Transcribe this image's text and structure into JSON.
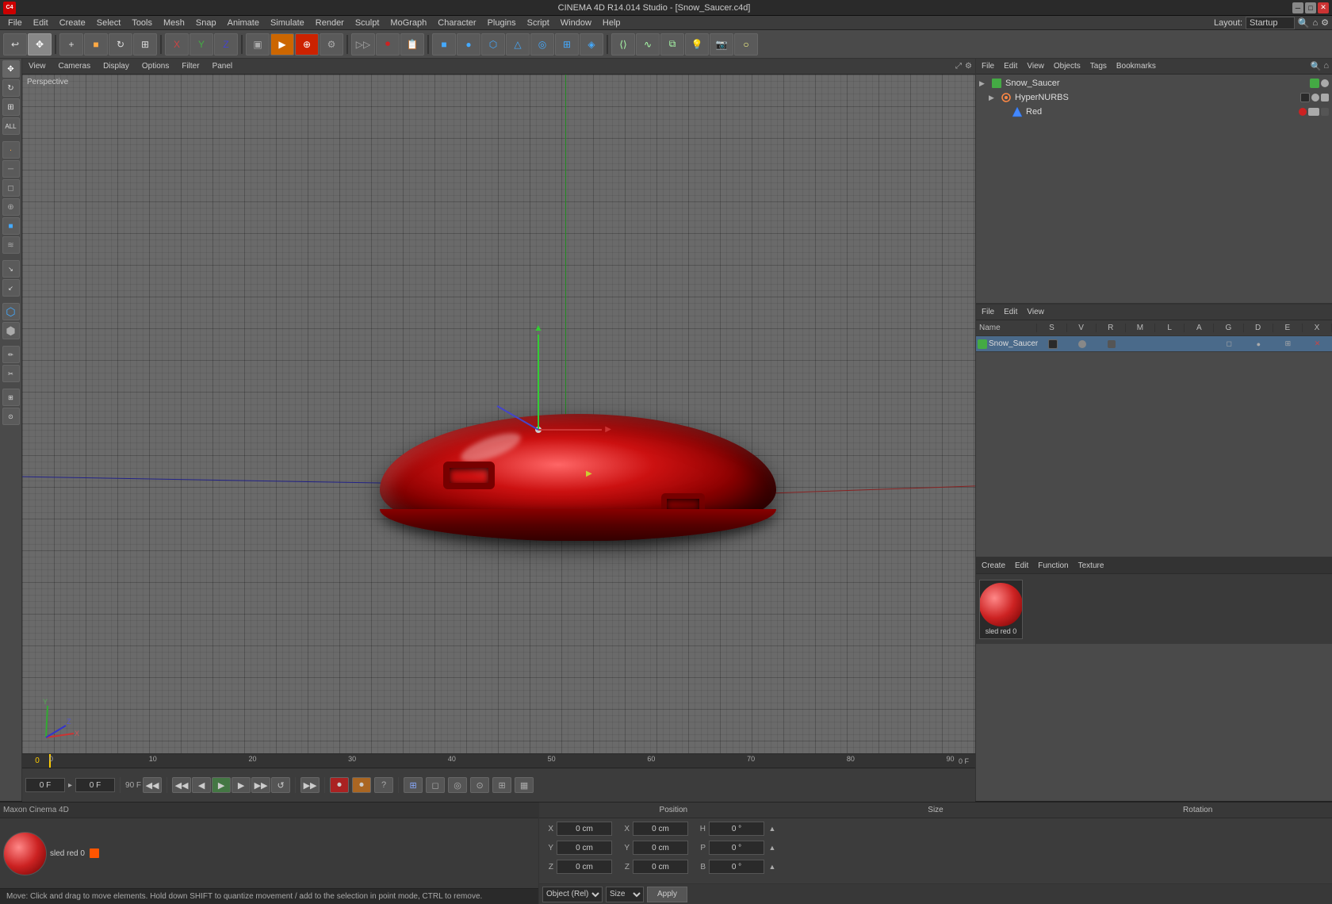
{
  "window": {
    "title": "CINEMA 4D R14.014 Studio - [Snow_Saucer.c4d]",
    "layout_label": "Layout:",
    "layout_value": "Startup"
  },
  "menubar": {
    "items": [
      "File",
      "Edit",
      "Create",
      "Select",
      "Tools",
      "Mesh",
      "Snap",
      "Animate",
      "Simulate",
      "Render",
      "Sculpt",
      "MoGraph",
      "Character",
      "Plugins",
      "Script",
      "Window",
      "Help"
    ]
  },
  "viewport": {
    "label": "Perspective",
    "menus": [
      "View",
      "Cameras",
      "Display",
      "Options",
      "Filter",
      "Panel"
    ]
  },
  "object_manager": {
    "toolbar": [
      "File",
      "Edit",
      "View",
      "Objects",
      "Tags",
      "Bookmarks"
    ],
    "objects": [
      {
        "name": "Snow_Saucer",
        "level": 0,
        "type": "null",
        "expanded": true
      },
      {
        "name": "HyperNURBS",
        "level": 1,
        "type": "hypernurbs",
        "expanded": true
      },
      {
        "name": "Red",
        "level": 2,
        "type": "mesh"
      }
    ]
  },
  "timeline": {
    "current_frame": "0 F",
    "start_frame": "0 F",
    "end_frame": "90 F",
    "min_frame": "0 F",
    "max_frame": "90 F",
    "ticks": [
      "0",
      "10",
      "20",
      "30",
      "40",
      "50",
      "60",
      "70",
      "80",
      "90"
    ],
    "controls": {
      "play_label": "▶",
      "rewind_label": "◀◀",
      "prev_label": "◀",
      "next_label": "▶",
      "forward_label": "▶▶",
      "record_label": "⏺"
    }
  },
  "attribute_manager": {
    "toolbar": [
      "File",
      "Edit",
      "View"
    ],
    "selected_object": "Snow_Saucer",
    "columns": {
      "name_header": "Name",
      "s_header": "S",
      "v_header": "V",
      "r_header": "R",
      "m_header": "M",
      "l_header": "L",
      "a_header": "A",
      "g_header": "G",
      "d_header": "D",
      "e_header": "E",
      "x_header": "X"
    },
    "objects": [
      {
        "name": "Snow_Saucer",
        "selected": true
      }
    ]
  },
  "coordinates": {
    "position_label": "Position",
    "size_label": "Size",
    "rotation_label": "Rotation",
    "x_pos": "0 cm",
    "y_pos": "0 cm",
    "z_pos": "0 cm",
    "x_size": "0 cm",
    "y_size": "0 cm",
    "z_size": "0 cm",
    "h_rot": "0 °",
    "p_rot": "0 °",
    "b_rot": "0 °",
    "coord_system": "Object (Rel)",
    "size_mode": "Size",
    "apply_btn": "Apply"
  },
  "material_manager": {
    "toolbar": [
      "Create",
      "Edit",
      "Function",
      "Texture"
    ],
    "materials": [
      {
        "name": "sled red 0",
        "selected": true
      }
    ]
  },
  "status_bar": {
    "message": "Move: Click and drag to move elements. Hold down SHIFT to quantize movement / add to the selection in point mode, CTRL to remove."
  }
}
